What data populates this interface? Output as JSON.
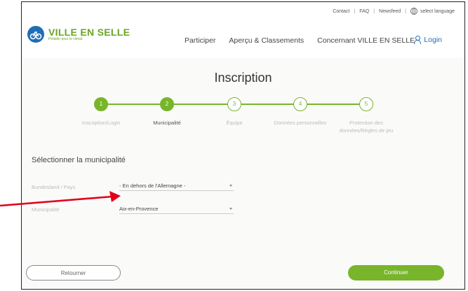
{
  "utility": {
    "contact": "Contact",
    "faq": "FAQ",
    "newsfeed": "Newsfeed",
    "language": "select language",
    "separator": "|"
  },
  "brand": {
    "name": "VILLE EN SELLE",
    "tagline": "Pédaler pour le climat",
    "color": "#6aa622",
    "logo_color": "#1f6db4"
  },
  "nav": {
    "items": [
      "Participer",
      "Aperçu & Classements",
      "Concernant VILLE EN SELLE"
    ],
    "login": "Login"
  },
  "page": {
    "title": "Inscription"
  },
  "steps": [
    {
      "num": "1",
      "label": "Inscription/Login",
      "status": "done"
    },
    {
      "num": "2",
      "label": "Municipalité",
      "status": "active"
    },
    {
      "num": "3",
      "label": "Équipe",
      "status": "todo"
    },
    {
      "num": "4",
      "label": "Données personnelles",
      "status": "todo"
    },
    {
      "num": "5",
      "label": "Protection des données/Règles de jeu",
      "status": "todo"
    }
  ],
  "form": {
    "section_title": "Sélectionner la municipalité",
    "state_label": "Bundesland / Pays",
    "state_value": "- En dehors de l'Allemagne -",
    "municipality_label": "Municipalité",
    "municipality_value": "Aix-en-Provence"
  },
  "buttons": {
    "back": "Retourner",
    "next": "Continuer"
  },
  "colors": {
    "accent": "#78b52a",
    "annotation_arrow": "#e3001b"
  }
}
